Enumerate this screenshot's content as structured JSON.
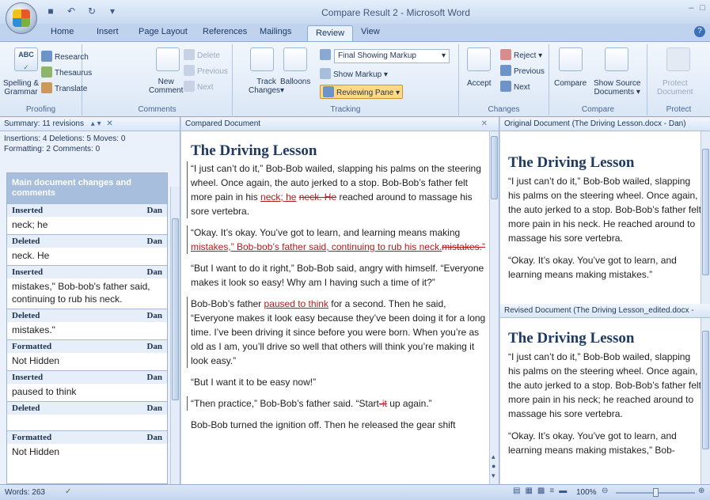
{
  "window": {
    "title": "Compare Result 2 - Microsoft Word"
  },
  "tabs": [
    "Home",
    "Insert",
    "Page Layout",
    "References",
    "Mailings",
    "Review",
    "View"
  ],
  "active_tab": "Review",
  "ribbon": {
    "proofing": {
      "spelling": "Spelling &",
      "grammar": "Grammar",
      "research": "Research",
      "thesaurus": "Thesaurus",
      "translate": "Translate",
      "label": "Proofing"
    },
    "comments": {
      "new_comment_1": "New",
      "new_comment_2": "Comment",
      "delete": "Delete",
      "previous": "Previous",
      "next": "Next",
      "label": "Comments"
    },
    "tracking": {
      "track_changes_1": "Track",
      "track_changes_2": "Changes",
      "balloons": "Balloons",
      "display": "Final Showing Markup",
      "show_markup": "Show Markup",
      "reviewing_pane": "Reviewing Pane",
      "label": "Tracking"
    },
    "changes": {
      "accept": "Accept",
      "reject": "Reject",
      "previous": "Previous",
      "next": "Next",
      "label": "Changes"
    },
    "compare": {
      "compare": "Compare",
      "show_source_1": "Show Source",
      "show_source_2": "Documents",
      "label": "Compare"
    },
    "protect": {
      "protect_1": "Protect",
      "protect_2": "Document",
      "label": "Protect"
    }
  },
  "summary": {
    "title": "Summary: 11 revisions",
    "counts_1": "Insertions: 4 Deletions: 5 Moves: 0",
    "counts_2": "Formatting: 2 Comments: 0",
    "header": "Main document changes and comments",
    "items": [
      {
        "type": "Inserted",
        "author": "Dan",
        "text": "neck; he"
      },
      {
        "type": "Deleted",
        "author": "Dan",
        "text": "neck. He"
      },
      {
        "type": "Inserted",
        "author": "Dan",
        "text": "mistakes,\" Bob-bob's father said, continuing to rub his neck."
      },
      {
        "type": "Deleted",
        "author": "Dan",
        "text": "mistakes.\""
      },
      {
        "type": "Formatted",
        "author": "Dan",
        "text": "Not Hidden"
      },
      {
        "type": "Inserted",
        "author": "Dan",
        "text": "paused to think"
      },
      {
        "type": "Deleted",
        "author": "Dan",
        "text": ""
      },
      {
        "type": "Formatted",
        "author": "Dan",
        "text": "Not Hidden"
      }
    ]
  },
  "compared": {
    "pane_title": "Compared Document",
    "title": "The Driving Lesson",
    "p1_a": "“I just can’t do it,” Bob-Bob wailed, slapping his palms on the steering wheel. Once again, the auto jerked to a stop. Bob-Bob’s father felt more pain in his ",
    "p1_ins": "neck; he",
    "p1_del": "neck. He",
    "p1_b": " reached around to massage his sore vertebra.",
    "p2_a": "“Okay. It’s okay. You’ve got to learn, and learning means making ",
    "p2_ins": "mistakes,” Bob-bob’s father said, continuing to rub his neck.",
    "p2_del": "mistakes.”",
    "p3": "“But I want to do it right,” Bob-Bob said, angry with himself. “Everyone makes it look so easy! Why am I having such a time of it?”",
    "p4_a": "Bob-Bob’s father ",
    "p4_ins": "paused to think",
    "p4_b": " for a second. Then he said, “Everyone makes it look easy because they’ve been doing it for a long time. I’ve been driving it since before you were born. When you’re as old as I am, you’ll drive so well that others will think you’re making it look easy.”",
    "p5": "“But I want it to be easy now!”",
    "p6_a": "“Then practice,” Bob-Bob’s father said. “Start",
    "p6_del": "-it",
    "p6_b": " up again.”",
    "p7": "Bob-Bob turned the ignition off. Then he released the gear shift"
  },
  "original": {
    "pane_title": "Original Document (The Driving Lesson.docx - Dan)",
    "title": "The Driving Lesson",
    "p1": "“I just can’t do it,” Bob-Bob wailed, slapping his palms on the steering wheel. Once again, the auto jerked to a stop. Bob-Bob’s father felt more pain in his neck. He reached around to massage his sore vertebra.",
    "p2": "“Okay. It’s okay. You’ve got to learn, and learning means making mistakes.”"
  },
  "revised": {
    "pane_title": "Revised Document (The Driving Lesson_edited.docx -",
    "title": "The Driving Lesson",
    "p1": "“I just can’t do it,” Bob-Bob wailed, slapping his palms on the steering wheel. Once again, the auto jerked to a stop. Bob-Bob’s father felt more pain in his neck; he reached around to massage his sore vertebra.",
    "p2": "“Okay. It’s okay. You’ve got to learn, and learning means making mistakes,” Bob-"
  },
  "status": {
    "words": "Words: 263",
    "zoom": "100%"
  },
  "colors": {
    "revision_red": "#b31a1a",
    "ribbon_blue": "#c9d8ec",
    "heading_blue": "#1e3a63"
  }
}
